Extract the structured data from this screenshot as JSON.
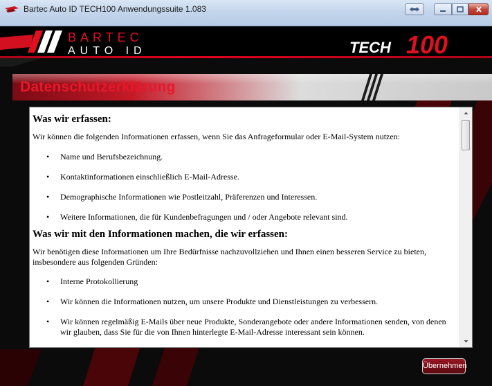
{
  "window": {
    "title": "Bartec Auto ID TECH100 Anwendungssuite 1.083"
  },
  "header": {
    "logo_top": "BARTEC",
    "logo_bottom": "AUTO ID",
    "product": "TECH",
    "product_number": "100"
  },
  "colors": {
    "accent": "#e8182a",
    "background": "#0b0b0b",
    "title_bar": "#c4d6ec"
  },
  "page": {
    "title": "Datenschutzerklärung"
  },
  "document": {
    "section1_heading": "Was wir erfassen:",
    "section1_intro": "Wir können die folgenden Informationen erfassen, wenn Sie das Anfrageformular oder E-Mail-System nutzen:",
    "section1_items": [
      "Name und Berufsbezeichnung.",
      "Kontaktinformationen einschließlich E-Mail-Adresse.",
      "Demographische Informationen wie Postleitzahl, Präferenzen und Interessen.",
      "Weitere Informationen, die für Kundenbefragungen und / oder Angebote relevant sind."
    ],
    "section2_heading": "Was wir mit den Informationen machen, die wir erfassen:",
    "section2_intro": "Wir benötigen diese Informationen um Ihre Bedürfnisse nachzuvollziehen und Ihnen einen besseren Service zu bieten, insbesondere aus folgenden Gründen:",
    "section2_items": [
      "Interne Protokollierung",
      "Wir können die Informationen nutzen, um unsere Produkte und Dienstleistungen zu verbessern.",
      "Wir können regelmäßig E-Mails über neue Produkte, Sonderangebote oder andere Informationen senden, von denen wir glauben, dass Sie für die von Ihnen hinterlegte E-Mail-Adresse interessant sein können."
    ]
  },
  "buttons": {
    "apply": "Übernehmen"
  },
  "icons": {
    "app": "bartec-logo-icon",
    "fit": "fit-window-icon",
    "minimize": "minimize-icon",
    "maximize": "maximize-icon",
    "close": "close-icon"
  }
}
